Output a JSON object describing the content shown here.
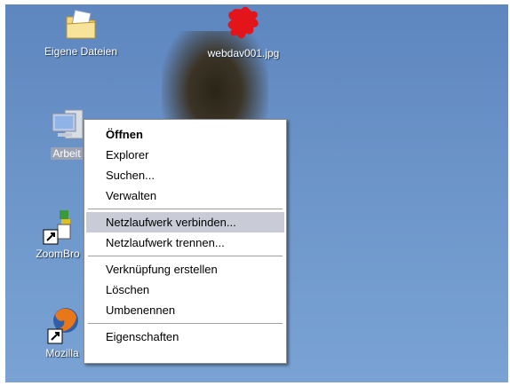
{
  "desktop": {
    "icons": [
      {
        "label": "Eigene Dateien",
        "icon": "folder-documents-icon"
      },
      {
        "label": "webdav001.jpg",
        "icon": "image-file-icon"
      },
      {
        "label": "Arbeit",
        "icon": "computer-icon"
      },
      {
        "label": "ZoomBro",
        "icon": "zoombrowser-shortcut-icon"
      },
      {
        "label": "Mozilla",
        "icon": "firefox-shortcut-icon"
      }
    ]
  },
  "context_menu": {
    "groups": [
      [
        "Öffnen",
        "Explorer",
        "Suchen...",
        "Verwalten"
      ],
      [
        "Netzlaufwerk verbinden...",
        "Netzlaufwerk trennen..."
      ],
      [
        "Verknüpfung erstellen",
        "Löschen",
        "Umbenennen"
      ],
      [
        "Eigenschaften"
      ]
    ],
    "default_item": "Öffnen",
    "highlighted_item": "Netzlaufwerk verbinden..."
  },
  "colors": {
    "desktop_blue": "#6a93c8",
    "menu_highlight": "#c9ccd6",
    "icon_selected": "#9aa2b4"
  }
}
